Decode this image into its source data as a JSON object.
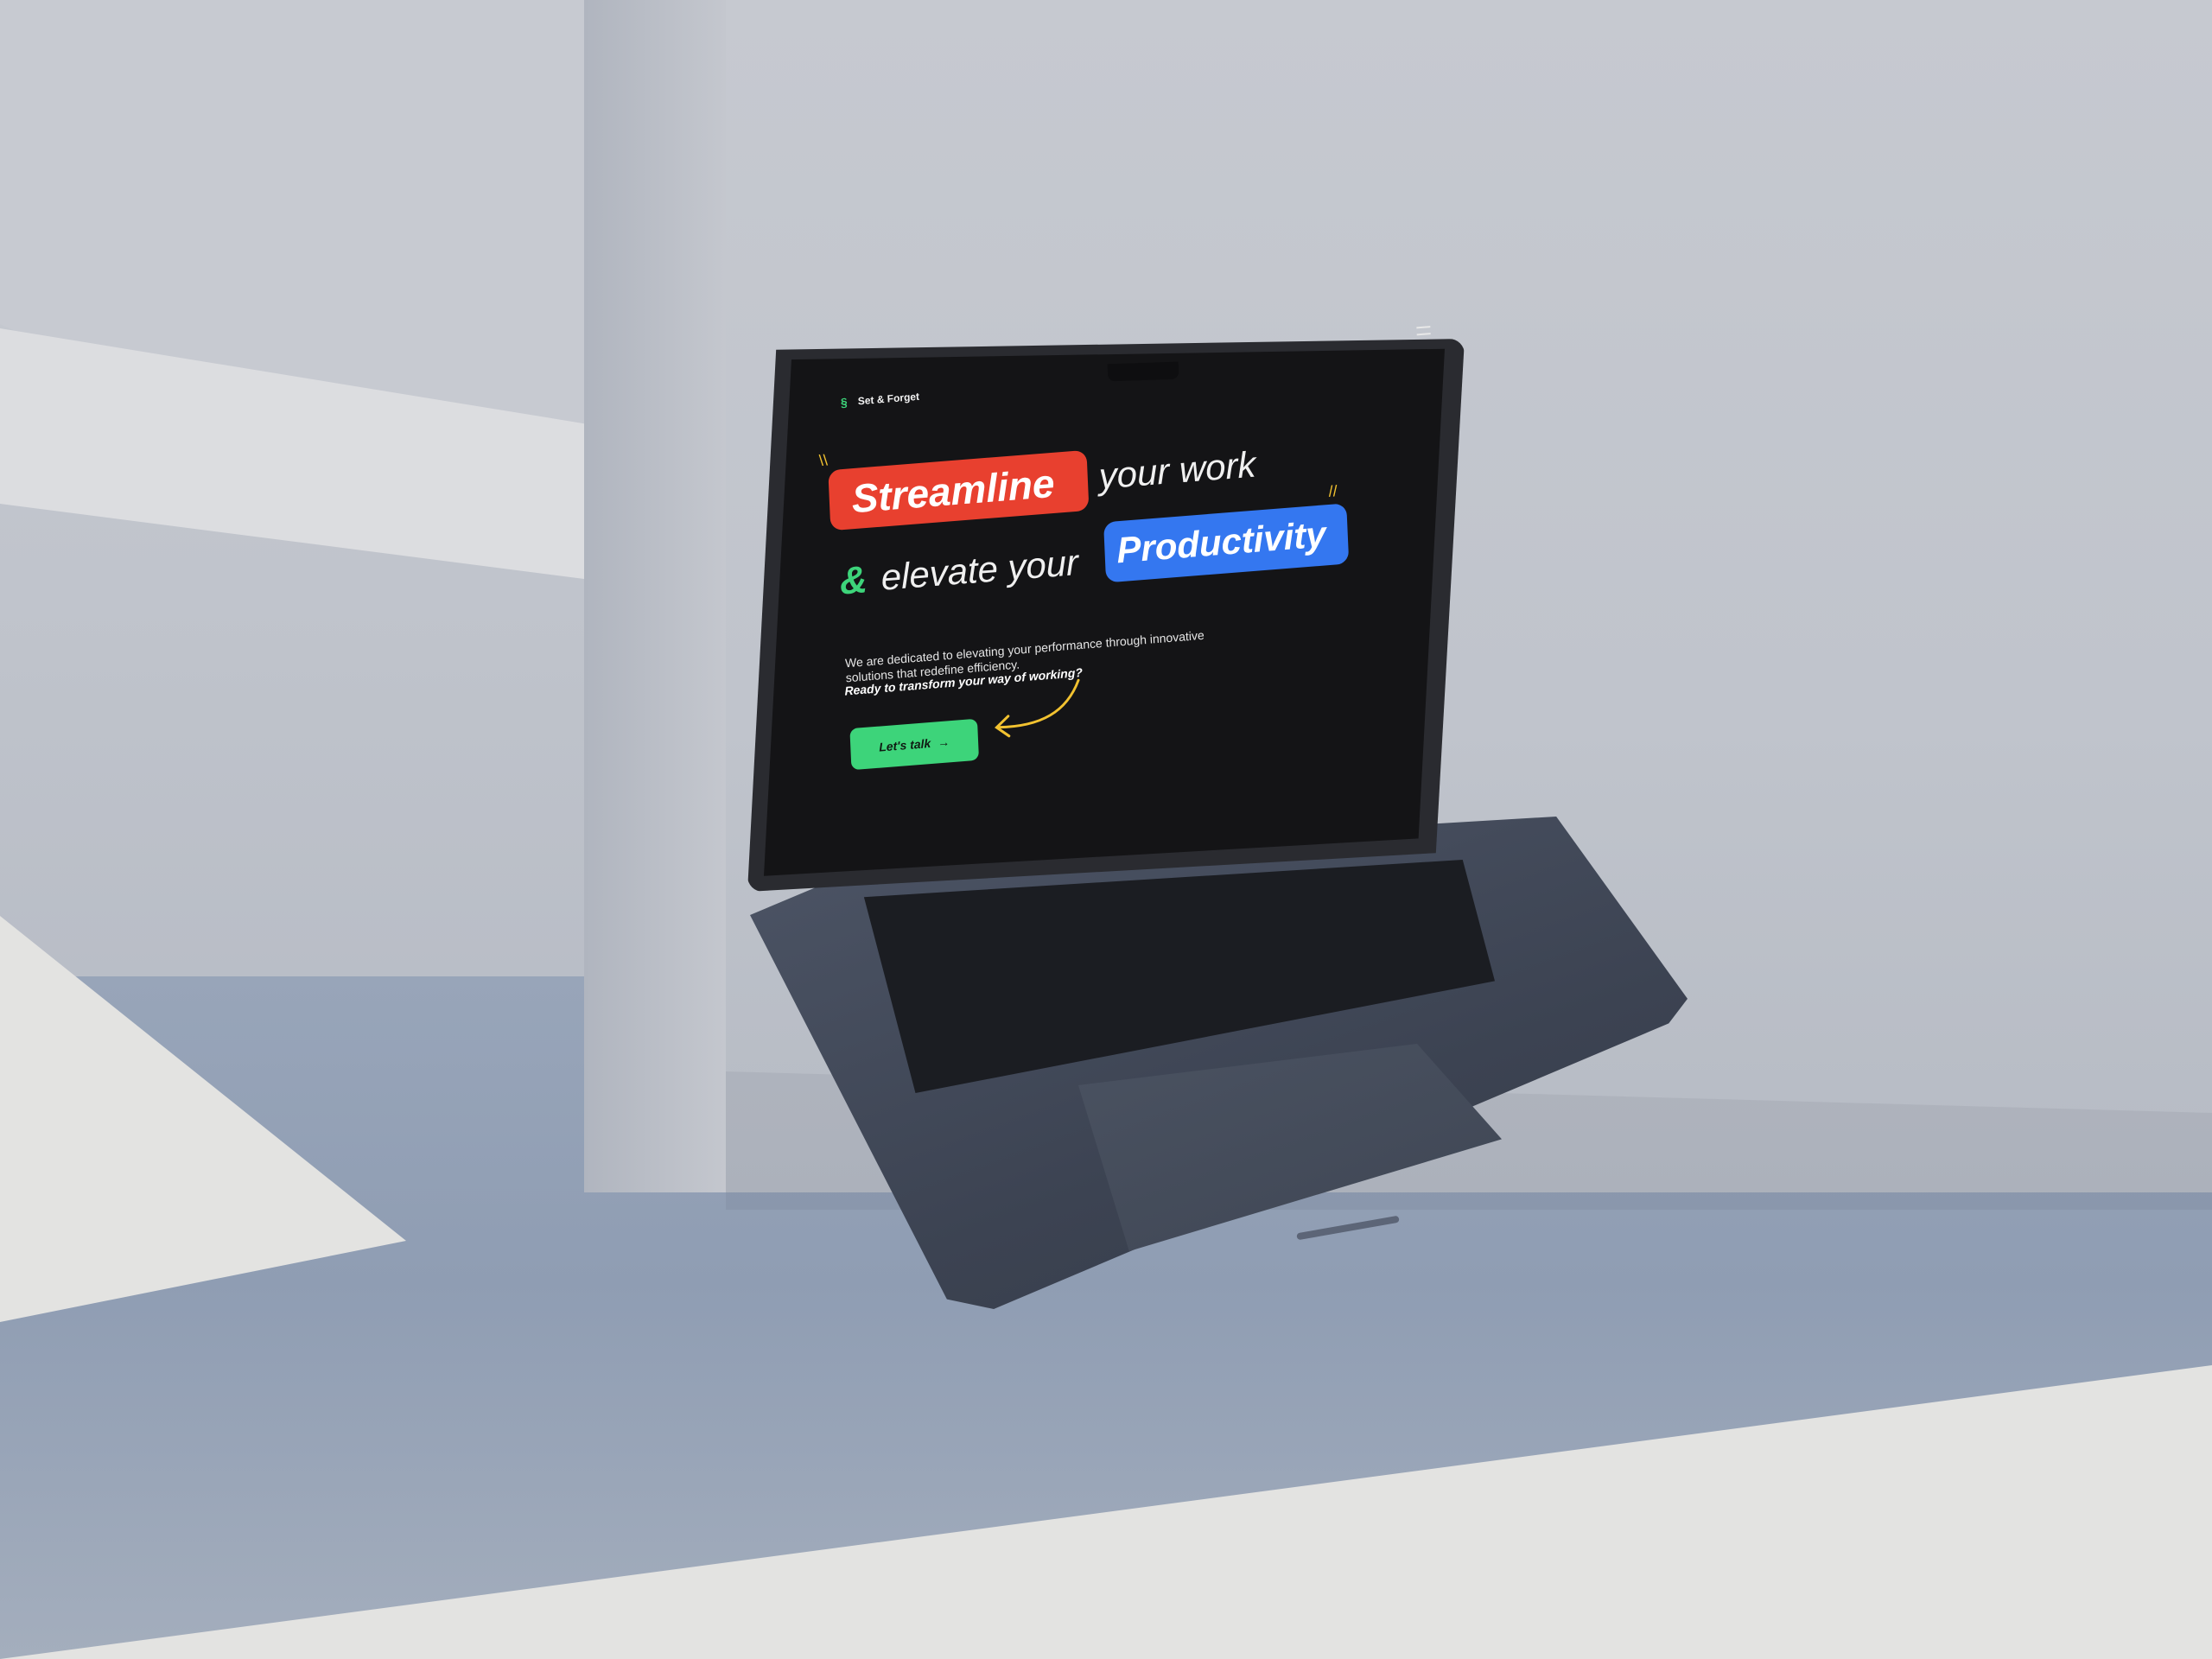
{
  "brand": {
    "name": "Set & Forget",
    "logo_icon": "sf-logo-icon",
    "accent": "#3dd47a"
  },
  "hero": {
    "word_highlight_1": "Streamline",
    "line1_rest": "your work",
    "ampersand": "&",
    "line2_text": "elevate your",
    "word_highlight_2": "Productivity",
    "description": "We are dedicated to elevating your performance through innovative solutions that redefine efficiency.",
    "question": "Ready to transform your way of working?",
    "cta_label": "Let's talk",
    "cta_icon": "arrow-right-icon"
  },
  "colors": {
    "red_pill": "#e8402f",
    "blue_pill": "#3477f0",
    "background": "#141416",
    "green": "#3dd47a",
    "spark": "#f2c230"
  },
  "nav": {
    "menu_icon": "hamburger-icon"
  }
}
